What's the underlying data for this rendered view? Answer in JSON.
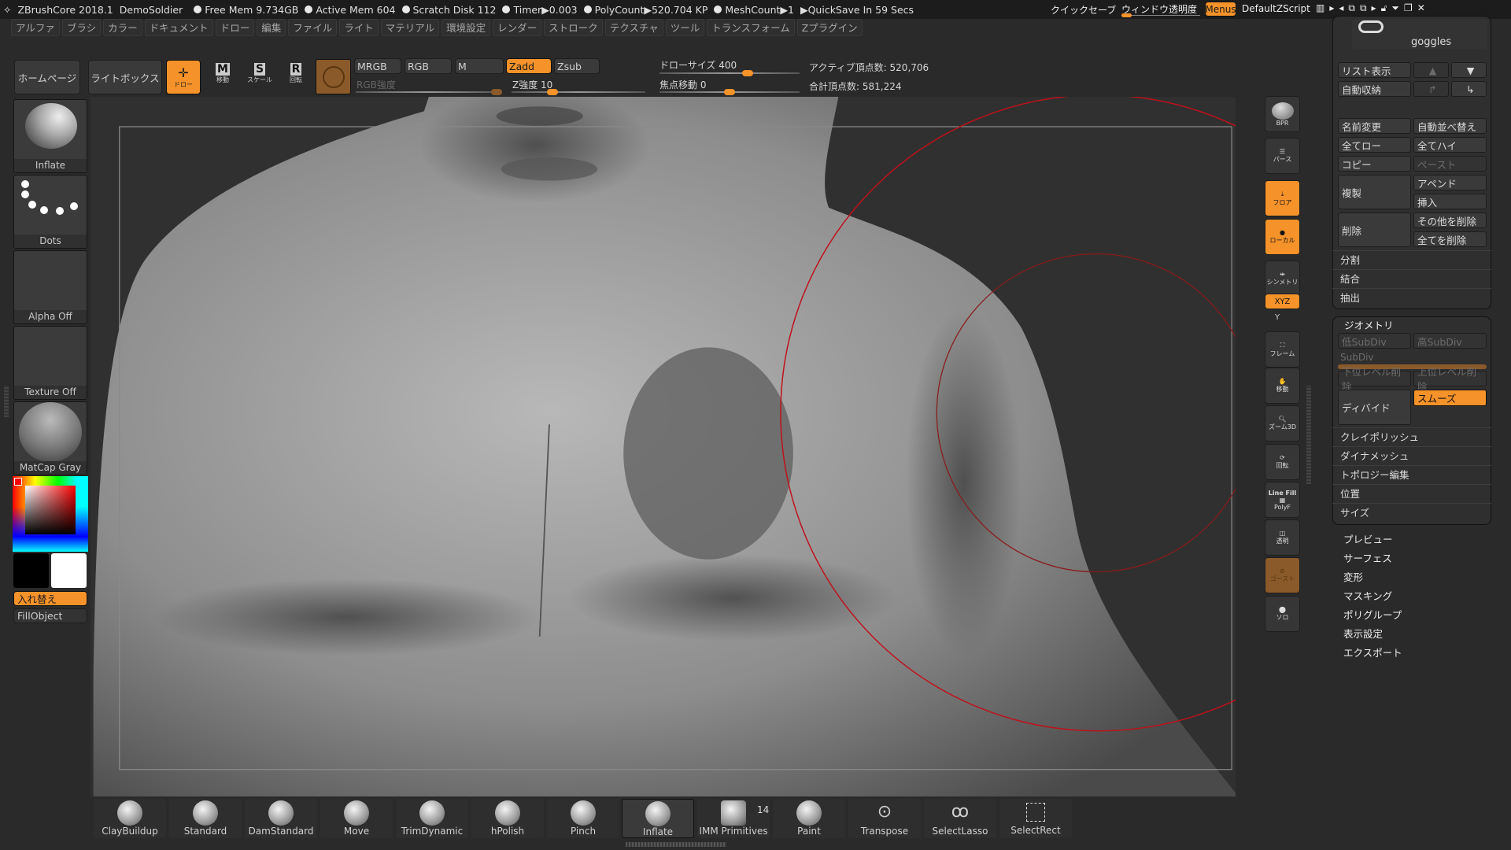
{
  "titlebar": {
    "app": "ZBrushCore 2018.1",
    "project": "DemoSoldier",
    "free_mem": "Free Mem 9.734GB",
    "active_mem": "Active Mem 604",
    "scratch": "Scratch Disk 112",
    "timer": "Timer▶0.003",
    "polycount": "PolyCount▶520.704 KP",
    "meshcount": "MeshCount▶1",
    "quicksave": "▶QuickSave In 59 Secs",
    "quick_save_btn": "クイックセーブ",
    "window_transparency": "ウィンドウ透明度",
    "menus": "Menus",
    "script": "DefaultZScript"
  },
  "menus": [
    "アルファ",
    "ブラシ",
    "カラー",
    "ドキュメント",
    "ドロー",
    "編集",
    "ファイル",
    "ライト",
    "マテリアル",
    "環境設定",
    "レンダー",
    "ストローク",
    "テクスチャ",
    "ツール",
    "トランスフォーム",
    "Zプラグイン"
  ],
  "toolbar": {
    "home": "ホームページ",
    "lightbox": "ライトボックス",
    "draw": "ドロー",
    "move": "移動",
    "scale": "スケール",
    "rotate": "回転",
    "mrgb": "MRGB",
    "rgb": "RGB",
    "m": "M",
    "zadd": "Zadd",
    "zsub": "Zsub",
    "rgb_intensity": "RGB強度",
    "z_intensity": "Z強度 10",
    "draw_size": "ドローサイズ 400",
    "focal_shift": "焦点移動 0",
    "active_points": "アクティブ頂点数: 520,706",
    "total_points": "合計頂点数: 581,224",
    "z_intensity_value": 10,
    "draw_size_value": 400,
    "focal_shift_value": 0
  },
  "left": {
    "brush": "Inflate",
    "stroke": "Dots",
    "alpha": "Alpha Off",
    "texture": "Texture Off",
    "material": "MatCap Gray",
    "swap": "入れ替え",
    "fill": "FillObject",
    "main_color": "#ff0000",
    "secondary_color": "#ffffff"
  },
  "righticons": [
    "BPR",
    "パース",
    "フロア",
    "ローカル",
    "シンメトリ",
    "XYZ",
    "Y",
    "フレーム",
    "移動",
    "ズーム3D",
    "Line Fill",
    "PolyF",
    "回転",
    "透明",
    "ゴースト",
    "ソロ"
  ],
  "subtool": {
    "name": "goggles",
    "list": "リスト表示",
    "auto": "自動収納",
    "rename": "名前変更",
    "autosort": "自動並べ替え",
    "all_low": "全てロー",
    "all_high": "全てハイ",
    "copy": "コピー",
    "paste": "ペースト",
    "duplicate": "複製",
    "append": "アペンド",
    "insert": "挿入",
    "delete": "削除",
    "del_other": "その他を削除",
    "del_all": "全てを削除",
    "split": "分割",
    "merge": "結合",
    "extract": "抽出"
  },
  "geometry": {
    "title": "ジオメトリ",
    "lower": "低SubDiv",
    "higher": "高SubDiv",
    "subdiv": "SubDiv",
    "del_lower": "下位レベル削除",
    "del_higher": "上位レベル削除",
    "divide": "ディバイド",
    "smooth": "スムーズ",
    "items": [
      "クレイポリッシュ",
      "ダイナメッシュ",
      "トポロジー編集",
      "位置",
      "サイズ"
    ]
  },
  "subpalettes": [
    "プレビュー",
    "サーフェス",
    "変形",
    "マスキング",
    "ポリグループ",
    "表示設定",
    "エクスポート"
  ],
  "brushes": [
    "ClayBuildup",
    "Standard",
    "DamStandard",
    "Move",
    "TrimDynamic",
    "hPolish",
    "Pinch",
    "Inflate",
    "IMM Primitives",
    "Paint",
    "Transpose",
    "SelectLasso",
    "SelectRect"
  ],
  "imm_count": "14",
  "accent": "#f5922a"
}
